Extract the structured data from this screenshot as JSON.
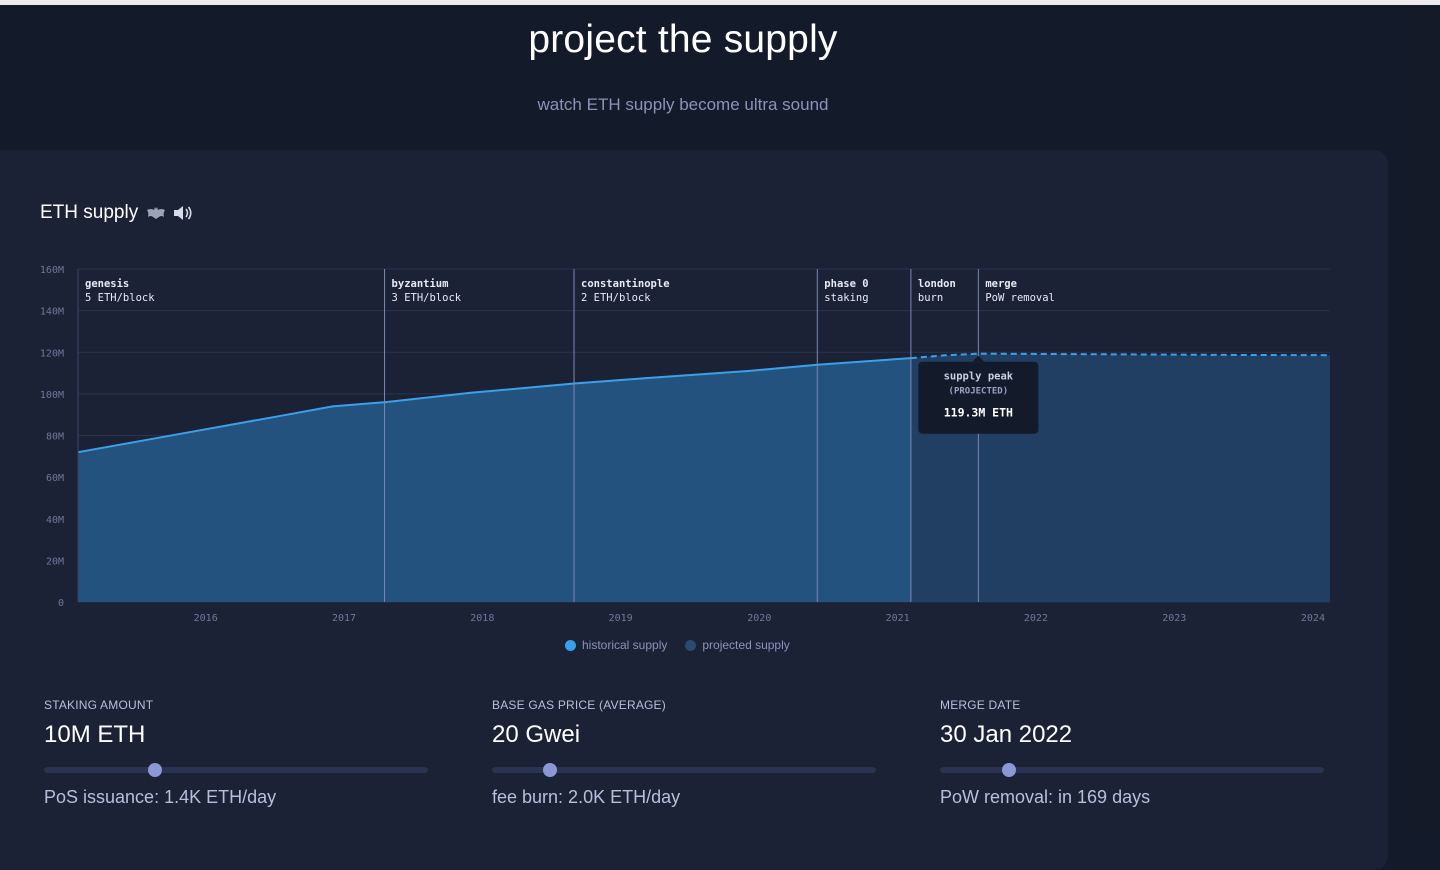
{
  "header": {
    "title": "project the supply",
    "subtitle": "watch ETH supply become ultra sound"
  },
  "card": {
    "title": "ETH supply",
    "title_icons": [
      "bat-icon",
      "speaker-icon"
    ]
  },
  "colors": {
    "historical": "#3aa0ea",
    "projected": "#2b4a6e",
    "background": "#1b2236",
    "thumb": "#8c97d6"
  },
  "chart_data": {
    "type": "area",
    "title": "ETH supply",
    "y_ticks": [
      "0",
      "20M",
      "40M",
      "60M",
      "80M",
      "100M",
      "120M",
      "140M",
      "160M"
    ],
    "ylim": [
      0,
      160
    ],
    "y_unit": "M ETH",
    "x_ticks": [
      "2016",
      "2017",
      "2018",
      "2019",
      "2020",
      "2021",
      "2022",
      "2023",
      "2024"
    ],
    "xlim": [
      "2015-07-30",
      "2024-08-15"
    ],
    "grid": true,
    "series": [
      {
        "name": "historical supply",
        "style": "solid",
        "points": [
          [
            "2015-07-30",
            72
          ],
          [
            "2016-01-01",
            77
          ],
          [
            "2016-06-01",
            82
          ],
          [
            "2017-01-01",
            89
          ],
          [
            "2017-06-01",
            94
          ],
          [
            "2017-10-16",
            96
          ],
          [
            "2018-06-01",
            100.5
          ],
          [
            "2019-02-28",
            105
          ],
          [
            "2019-09-01",
            107.5
          ],
          [
            "2020-06-01",
            111
          ],
          [
            "2020-12-01",
            114
          ],
          [
            "2021-08-05",
            117.2
          ]
        ]
      },
      {
        "name": "projected supply",
        "style": "dashed",
        "points": [
          [
            "2021-08-05",
            117.2
          ],
          [
            "2021-11-01",
            118.5
          ],
          [
            "2022-01-30",
            119.3
          ],
          [
            "2022-06-01",
            119.2
          ],
          [
            "2023-01-01",
            119.0
          ],
          [
            "2024-01-01",
            118.7
          ],
          [
            "2024-08-15",
            118.6
          ]
        ]
      }
    ],
    "annotations": [
      {
        "date": "2015-07-30",
        "title": "genesis",
        "subtitle": "5 ETH/block"
      },
      {
        "date": "2017-10-16",
        "title": "byzantium",
        "subtitle": "3 ETH/block"
      },
      {
        "date": "2019-02-28",
        "title": "constantinople",
        "subtitle": "2 ETH/block"
      },
      {
        "date": "2020-12-01",
        "title": "phase 0",
        "subtitle": "staking"
      },
      {
        "date": "2021-08-05",
        "title": "london",
        "subtitle": "burn"
      },
      {
        "date": "2022-01-30",
        "title": "merge",
        "subtitle": "PoW removal"
      }
    ],
    "tooltip": {
      "date": "2022-01-30",
      "title": "supply peak",
      "subtitle": "(PROJECTED)",
      "value": "119.3M ETH"
    },
    "legend": [
      "historical supply",
      "projected supply"
    ],
    "legend_position": "bottom-center"
  },
  "controls": [
    {
      "label": "STAKING AMOUNT",
      "value": "10M ETH",
      "position": 0.29,
      "note": "PoS issuance: 1.4K ETH/day"
    },
    {
      "label": "BASE GAS PRICE (AVERAGE)",
      "value": "20 Gwei",
      "position": 0.15,
      "note": "fee burn: 2.0K ETH/day"
    },
    {
      "label": "MERGE DATE",
      "value": "30 Jan 2022",
      "position": 0.18,
      "note": "PoW removal: in 169 days"
    }
  ]
}
